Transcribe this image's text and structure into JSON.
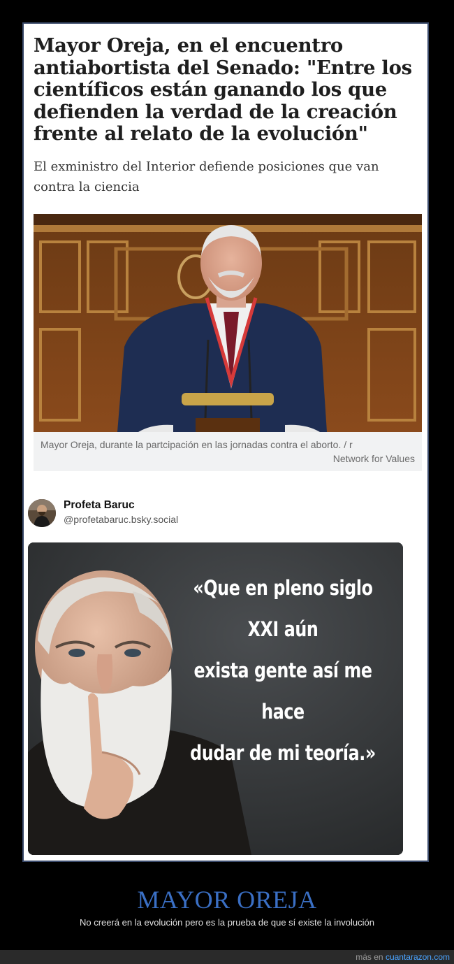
{
  "article": {
    "headline_lines": [
      "Mayor Oreja, en el encuentro",
      "antiabortista del Senado: \"Entre los",
      "científicos están ganando los que",
      "defienden la verdad de la creación",
      "frente al relato de la evolución\""
    ],
    "subheadline_lines": [
      "El exministro del Interior defiende posiciones que van",
      "contra la ciencia"
    ],
    "caption_line1": "Mayor Oreja, durante la partcipación en las jornadas contra el aborto. / r",
    "caption_line2": "Network for Values"
  },
  "post": {
    "author_name": "Profeta Baruc",
    "author_handle": "@profetabaruc.bsky.social",
    "quote_lines": [
      "«Que en pleno siglo XXI aún",
      "exista gente así me hace",
      "dudar de mi teoría.»"
    ]
  },
  "meme_caption": {
    "title": "MAYOR OREJA",
    "subtitle": "No creerá en la evolución pero es la prueba de que sí existe la involución"
  },
  "footer": {
    "prefix": "más en",
    "site": "cuantarazon.com"
  },
  "colors": {
    "title_blue": "#3a6fc4",
    "link_blue": "#4aa3ff",
    "background": "#000000"
  }
}
